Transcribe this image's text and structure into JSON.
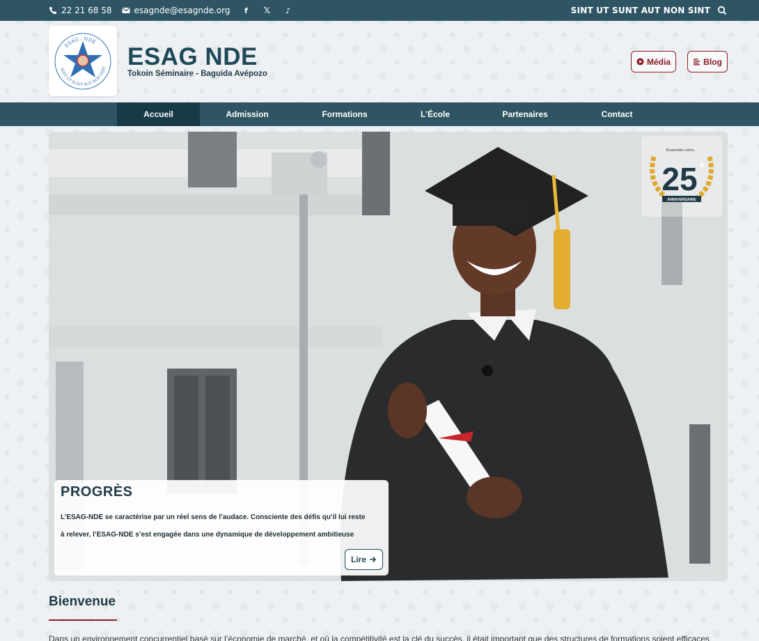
{
  "topbar": {
    "phone": "22 21 68 58",
    "email": "esagnde@esagnde.org",
    "social": [
      "facebook-icon",
      "x-icon",
      "tiktok-icon"
    ],
    "motto": "SINT UT SUNT AUT NON SINT"
  },
  "header": {
    "logo_text": "ESAG - NDE",
    "logo_motto": "SINT UT SUNT AUT NON SINT",
    "title": "ESAG NDE",
    "subtitle": "Tokoin Séminaire - Baguida Avépozo",
    "media_label": "Média",
    "blog_label": "Blog"
  },
  "nav": {
    "items": [
      {
        "label": "Accueil",
        "active": true
      },
      {
        "label": "Admission"
      },
      {
        "label": "Formations"
      },
      {
        "label": "L’École"
      },
      {
        "label": "Partenaires"
      },
      {
        "label": "Contact"
      }
    ]
  },
  "hero": {
    "badge_number": "25",
    "badge_sup": "e",
    "badge_label": "ANNIVERSAIRE",
    "badge_top": "Ensemble notre...",
    "caption_title": "PROGRÈS",
    "caption_text_line1": "L’ESAG-NDE se caractérise par un réel sens de l’audace. Consciente des défis qu’il lui reste",
    "caption_text_line2": "à relever, l’ESAG-NDE s’est engagée dans une dynamique de développement ambitieuse",
    "read_label": "Lire"
  },
  "welcome": {
    "title": "Bienvenue",
    "text": "Dans un environnement concurrentiel basé sur l’économie de marché, et où la compétitivité est la clé du succès, il était important que des structures de formations soient efficaces"
  },
  "colors": {
    "primary": "#2f5565",
    "primary_dark": "#173a47",
    "accent": "#8b1c24"
  }
}
